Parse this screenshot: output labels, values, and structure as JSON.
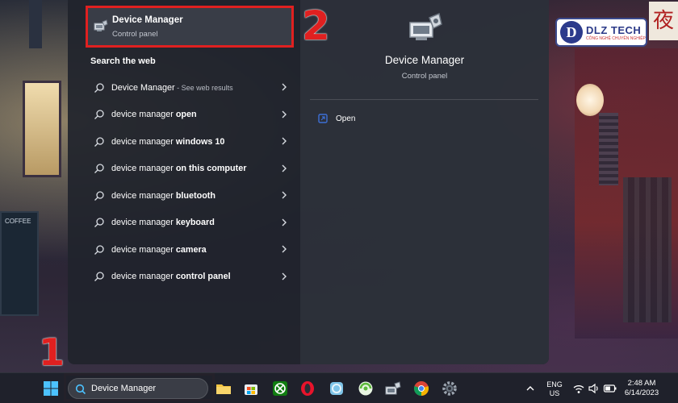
{
  "best_match": {
    "title": "Device Manager",
    "subtitle": "Control panel",
    "icon": "device-manager-icon"
  },
  "search_the_web": {
    "section_title": "Search the web",
    "items": [
      {
        "normal": "Device Manager",
        "bold": "",
        "muted": " - See web results"
      },
      {
        "normal": "device manager ",
        "bold": "open",
        "muted": ""
      },
      {
        "normal": "device manager ",
        "bold": "windows 10",
        "muted": ""
      },
      {
        "normal": "device manager ",
        "bold": "on this computer",
        "muted": ""
      },
      {
        "normal": "device manager ",
        "bold": "bluetooth",
        "muted": ""
      },
      {
        "normal": "device manager ",
        "bold": "keyboard",
        "muted": ""
      },
      {
        "normal": "device manager ",
        "bold": "camera",
        "muted": ""
      },
      {
        "normal": "device manager ",
        "bold": "control panel",
        "muted": ""
      }
    ]
  },
  "details": {
    "title": "Device Manager",
    "subtitle": "Control panel",
    "action_open": "Open"
  },
  "annotations": {
    "step1": "1",
    "step2": "2",
    "color": "#e02020"
  },
  "watermark": {
    "brand": "DLZ TECH",
    "tagline": "CÔNG NGHỆ CHUYÊN NGHIỆP",
    "kanji": "夜"
  },
  "background_sign": {
    "text": "COFFEE"
  },
  "taskbar": {
    "search_value": "Device Manager",
    "apps": [
      "windows-start-icon",
      "file-explorer-icon",
      "microsoft-store-icon",
      "xbox-icon",
      "opera-icon",
      "snipping-tool-icon",
      "green-app-icon",
      "device-manager-taskbar-icon",
      "chrome-icon",
      "settings-icon"
    ],
    "language_line1": "ENG",
    "language_line2": "US",
    "time": "2:48 AM",
    "date": "6/14/2023"
  },
  "colors": {
    "panel": "#20242c",
    "accent_red": "#e02020"
  }
}
